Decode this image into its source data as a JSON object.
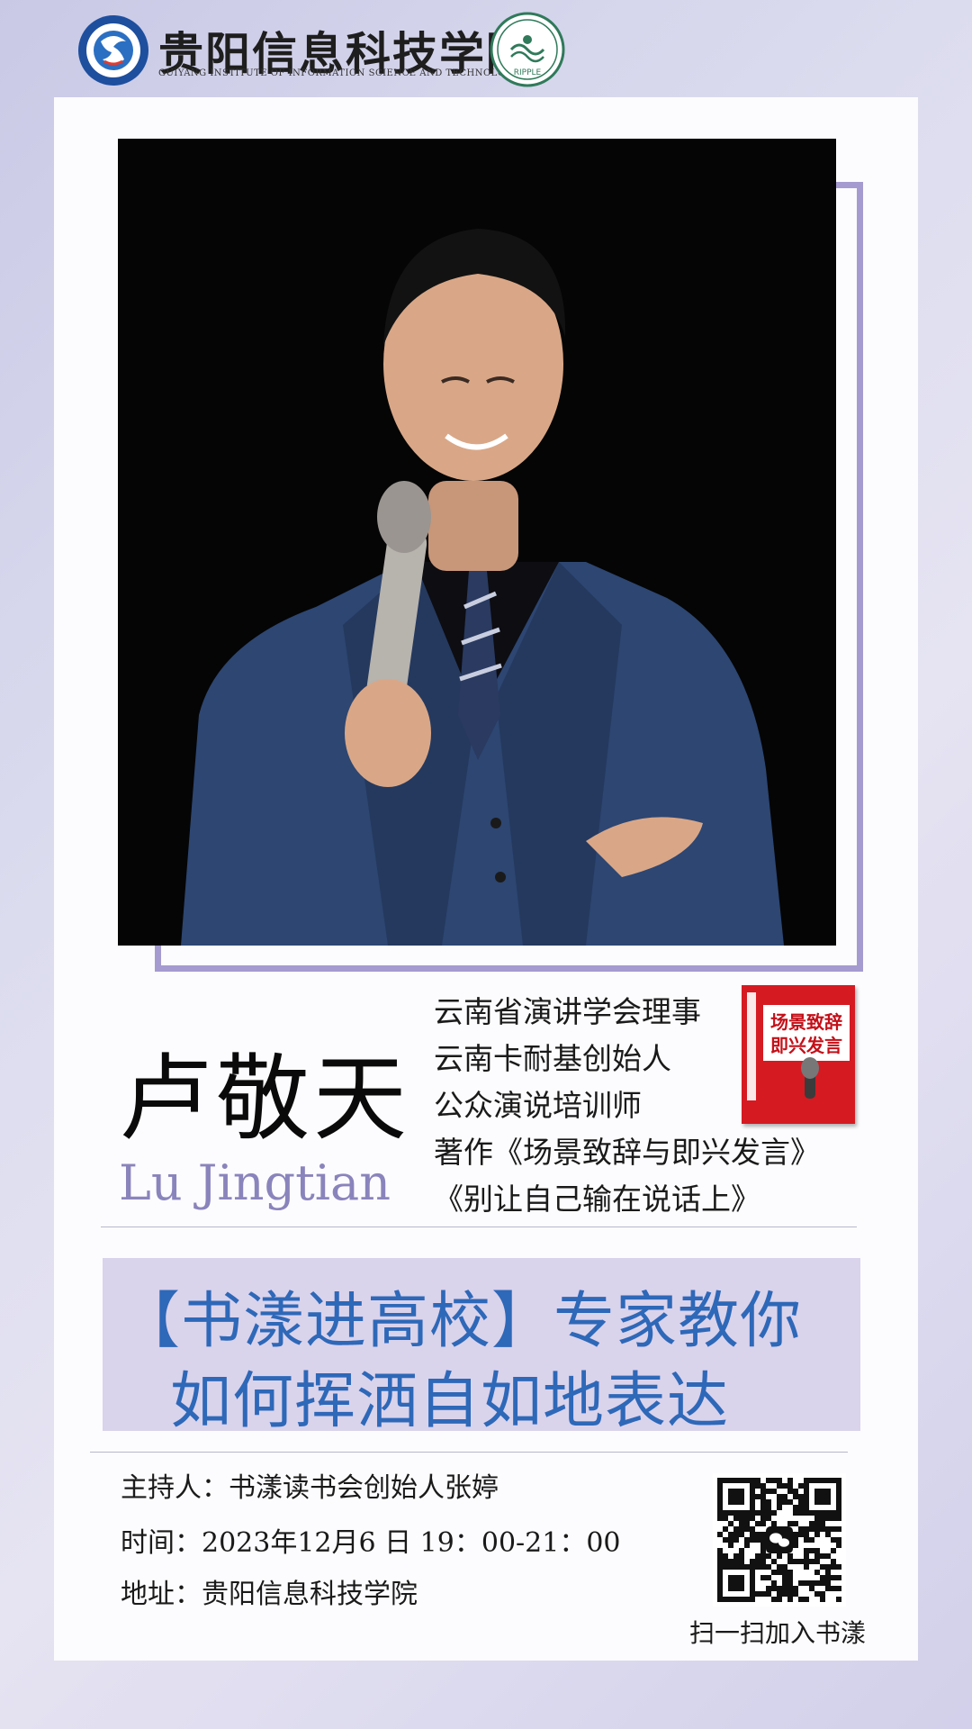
{
  "header": {
    "institute_cn": "贵阳信息科技学院",
    "institute_en": "GUIYANG INSTITUTE OF INFORMATION SCIENCE AND TECHNOLOGY",
    "left_logo_icon": "college-emblem-icon",
    "right_logo_icon": "ripple-club-emblem-icon",
    "right_logo_text": "RIPPLE"
  },
  "speaker": {
    "photo": "speaker-photo",
    "name_cn": "卢敬天",
    "name_en": "Lu Jingtian",
    "titles": [
      "云南省演讲学会理事",
      "云南卡耐基创始人",
      "公众演说培训师",
      "著作《场景致辞与即兴发言》",
      "《别让自己输在说话上》"
    ],
    "book_cover_text": [
      "场景致辞",
      "即兴发言"
    ]
  },
  "event": {
    "headline_line1": "【书漾进高校】专家教你",
    "headline_line2": "如何挥洒自如地表达",
    "host": "主持人：书漾读书会创始人张婷",
    "time": "时间：2023年12月6 日 19：00-21：00",
    "venue": "地址：贵阳信息科技学院"
  },
  "qr": {
    "icon": "wechat-qr-code-icon",
    "caption": "扫一扫加入书漾"
  },
  "colors": {
    "accent_purple": "#a59bd0",
    "headline_blue": "#2e68b8",
    "banner_bg": "#dad3ec",
    "name_en": "#8a84bc",
    "book_red": "#d51a22"
  }
}
